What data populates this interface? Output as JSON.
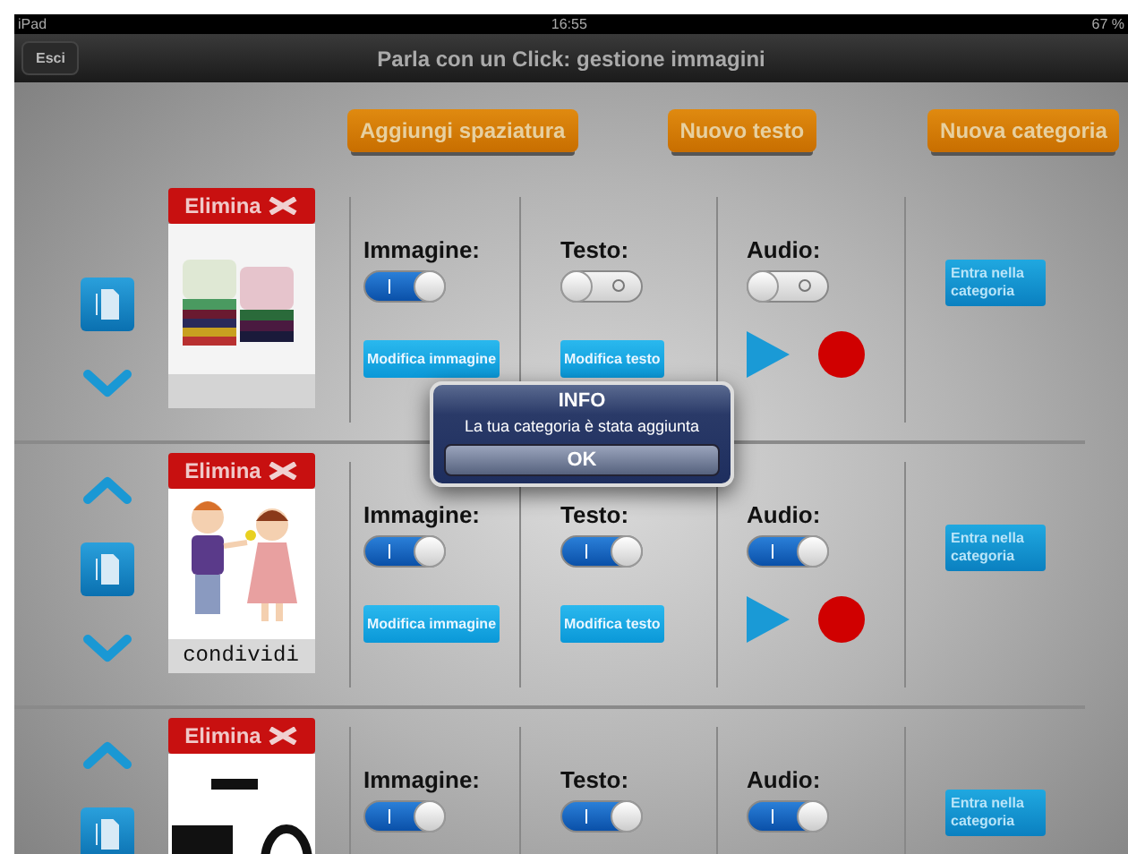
{
  "status_bar": {
    "device": "iPad",
    "time": "16:55",
    "battery": "67 %"
  },
  "nav_bar": {
    "back_button": "Esci",
    "title": "Parla con un Click: gestione immagini"
  },
  "toolbar": [
    "Aggiungi spaziatura",
    "Nuovo testo",
    "Nuova categoria"
  ],
  "rows": [
    {
      "move_up": false,
      "move_down": true,
      "delete_button": "Elimina",
      "image_label": "Immagine:",
      "image_on": true,
      "text_label": "Testo:",
      "text_on": false,
      "audio_label": "Audio:",
      "audio_on": false,
      "edit_image_button": "Modifica immagine",
      "edit_text_button": "Modifica testo",
      "player": true,
      "enter_button": "Entra nella categoria"
    },
    {
      "move_up": true,
      "move_down": true,
      "delete_button": "Elimina",
      "image": {
        "kind": "figures",
        "caption": "condividi"
      },
      "image_label": "Immagine:",
      "image_on": true,
      "text_label": "Testo:",
      "text_on": true,
      "audio_label": "Audio:",
      "audio_on": true,
      "edit_image_button": "Modifica immagine",
      "edit_text_button": "Modifica testo",
      "player": true,
      "enter_button": "Entra nella categoria"
    },
    {
      "move_up": true,
      "move_down": false,
      "delete_button": "Elimina",
      "image": {
        "kind": "shapes"
      },
      "image_label": "Immagine:",
      "image_on": true,
      "text_label": "Testo:",
      "text_on": true,
      "audio_label": "Audio:",
      "audio_on": true,
      "player": false,
      "enter_button": "Entra nella categoria"
    }
  ],
  "dialog": {
    "title": "INFO",
    "message": "La tua categoria è stata aggiunta",
    "button": "OK"
  }
}
